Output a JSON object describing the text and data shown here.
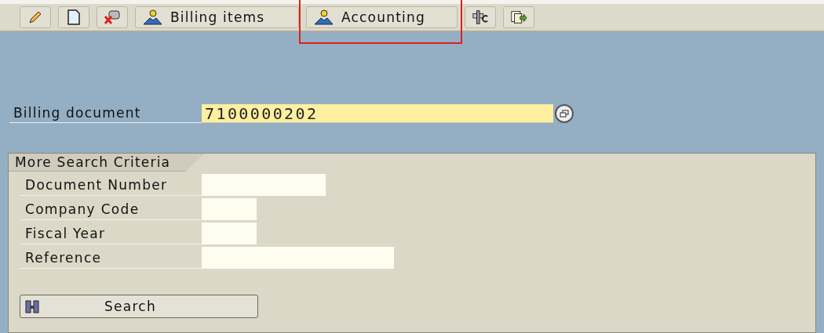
{
  "toolbar": {
    "buttons": [
      {
        "kind": "icon"
      },
      {
        "kind": "icon"
      },
      {
        "kind": "icon"
      },
      {
        "kind": "text",
        "label": "Billing items",
        "highlighted": false
      },
      {
        "kind": "text",
        "label": "Accounting",
        "highlighted": true
      },
      {
        "kind": "icon"
      },
      {
        "kind": "icon"
      }
    ]
  },
  "billing_document": {
    "label": "Billing document",
    "value": "7100000202"
  },
  "search_panel": {
    "title": "More Search Criteria",
    "fields": [
      {
        "label": "Document Number"
      },
      {
        "label": "Company Code"
      },
      {
        "label": "Fiscal Year"
      },
      {
        "label": "Reference"
      }
    ],
    "search_button": "Search"
  }
}
